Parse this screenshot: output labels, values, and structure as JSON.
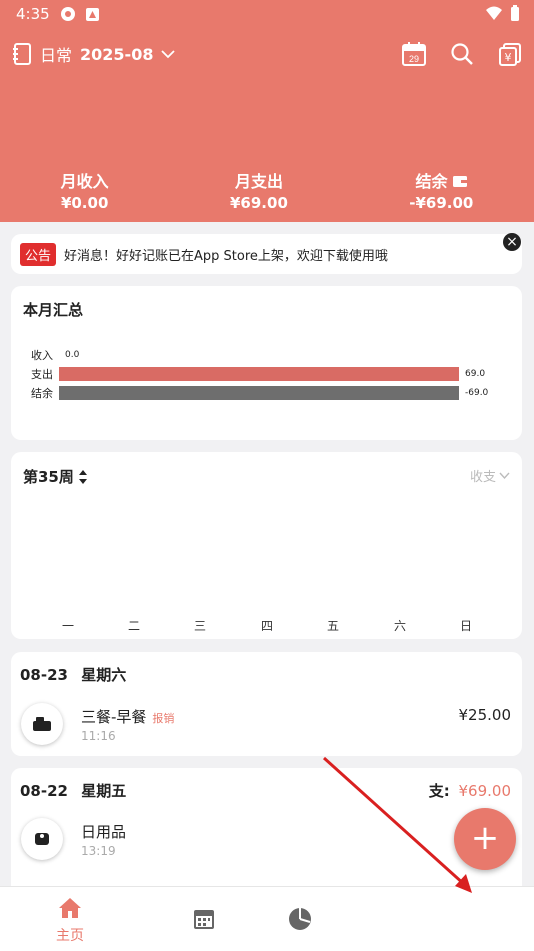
{
  "status_bar": {
    "time": "4:35"
  },
  "header": {
    "ledger_name": "日常",
    "month": "2025-08",
    "calendar_day": "29",
    "summary": [
      {
        "label": "月收入",
        "value": "¥0.00"
      },
      {
        "label": "月支出",
        "value": "¥69.00"
      },
      {
        "label": "结余",
        "value": "-¥69.00"
      }
    ]
  },
  "notice": {
    "tag": "公告",
    "text": "好消息！好好记账已在App Store上架，欢迎下载使用哦"
  },
  "monthly_summary": {
    "title": "本月汇总",
    "rows": [
      {
        "label": "收入",
        "value": "0.0",
        "num": 0,
        "color": "#d96b64"
      },
      {
        "label": "支出",
        "value": "69.0",
        "num": 69,
        "color": "#d96b64"
      },
      {
        "label": "结余",
        "value": "-69.0",
        "num": -69,
        "color": "#6e6e6e"
      }
    ]
  },
  "weekly": {
    "title": "第35周",
    "filter": "收支",
    "days": [
      "一",
      "二",
      "三",
      "四",
      "五",
      "六",
      "日"
    ]
  },
  "days": [
    {
      "date": "08-23",
      "weekday": "星期六",
      "entries": [
        {
          "name": "三餐-早餐",
          "tag": "报销",
          "time": "11:16",
          "amount": "¥25.00",
          "icon": "meal-icon"
        }
      ]
    },
    {
      "date": "08-22",
      "weekday": "星期五",
      "total_label": "支:",
      "total_value": "¥69.00",
      "entries": [
        {
          "name": "日用品",
          "time": "13:19",
          "amount": "",
          "icon": "toilet-paper-icon"
        }
      ]
    }
  ],
  "tabs": [
    {
      "label": "主页",
      "icon": "home-icon",
      "active": true
    },
    {
      "label": "",
      "icon": "calendar-icon"
    },
    {
      "label": "",
      "icon": "pie-chart-icon"
    }
  ],
  "colors": {
    "accent": "#e8796c",
    "danger": "#e02e2e"
  }
}
